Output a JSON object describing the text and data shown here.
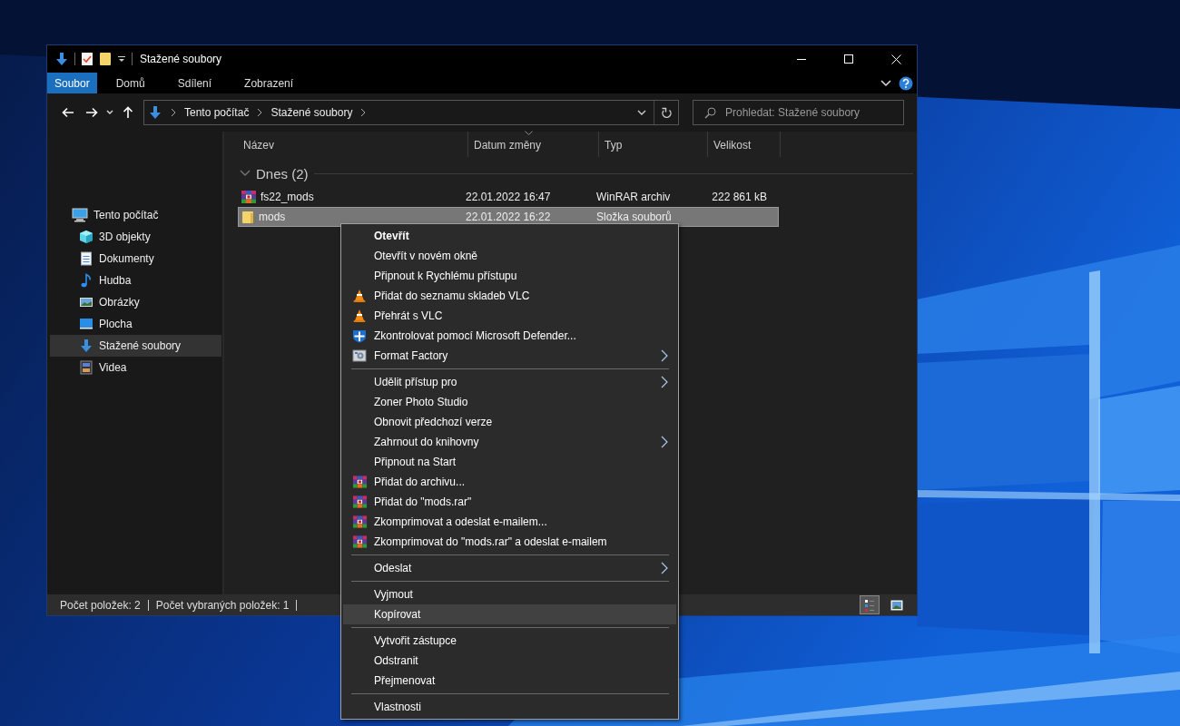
{
  "window": {
    "title": "Stažené soubory",
    "ribbon_tabs": [
      {
        "label": "Soubor",
        "selected": true
      },
      {
        "label": "Domů",
        "selected": false
      },
      {
        "label": "Sdílení",
        "selected": false
      },
      {
        "label": "Zobrazení",
        "selected": false
      }
    ],
    "address": {
      "crumbs": [
        "Tento počítač",
        "Stažené soubory"
      ]
    },
    "search": {
      "placeholder": "Prohledat: Stažené soubory"
    },
    "sidebar": {
      "items": [
        {
          "label": "Tento počítač",
          "kind": "pc",
          "selected": false,
          "children": [
            {
              "label": "3D objekty",
              "kind": "cube",
              "selected": false
            },
            {
              "label": "Dokumenty",
              "kind": "doc",
              "selected": false
            },
            {
              "label": "Hudba",
              "kind": "music",
              "selected": false
            },
            {
              "label": "Obrázky",
              "kind": "pictures",
              "selected": false
            },
            {
              "label": "Plocha",
              "kind": "desktop",
              "selected": false
            },
            {
              "label": "Stažené soubory",
              "kind": "download",
              "selected": true
            },
            {
              "label": "Videa",
              "kind": "video",
              "selected": false
            }
          ]
        }
      ]
    },
    "table": {
      "columns": [
        "Název",
        "Datum změny",
        "Typ",
        "Velikost"
      ],
      "group": "Dnes (2)",
      "rows": [
        {
          "name": "fs22_mods",
          "date": "22.01.2022 16:47",
          "type": "WinRAR archiv",
          "size": "222 861 kB",
          "kind": "archive",
          "selected": false
        },
        {
          "name": "mods",
          "date": "22.01.2022 16:22",
          "type": "Složka souborů",
          "kind": "folder",
          "selected": true
        }
      ]
    },
    "status_bar": {
      "items": [
        "Počet položek: 2",
        "Počet vybraných položek: 1"
      ],
      "views": [
        {
          "kind": "details",
          "selected": true
        },
        {
          "kind": "tiles",
          "selected": false
        }
      ]
    }
  },
  "context_menu": {
    "items": [
      {
        "kind": "plain",
        "label": "Otevřít",
        "default": true,
        "submenu": false,
        "selected": false
      },
      {
        "kind": "plain",
        "label": "Otevřít v novém okně",
        "default": false,
        "submenu": false,
        "selected": false
      },
      {
        "kind": "plain",
        "label": "Připnout k Rychlému přístupu",
        "default": false,
        "submenu": false,
        "selected": false
      },
      {
        "kind": "vlc",
        "label": "Přidat do seznamu skladeb VLC",
        "default": false,
        "submenu": false,
        "selected": false
      },
      {
        "kind": "vlc",
        "label": "Přehrát s VLC",
        "default": false,
        "submenu": false,
        "selected": false
      },
      {
        "kind": "defender",
        "label": "Zkontrolovat pomocí Microsoft Defender...",
        "default": false,
        "submenu": false,
        "selected": false
      },
      {
        "kind": "formatfactory",
        "label": "Format Factory",
        "default": false,
        "submenu": true,
        "selected": false
      },
      {
        "kind": "separator"
      },
      {
        "kind": "plain",
        "label": "Udělit přístup pro",
        "default": false,
        "submenu": true,
        "selected": false
      },
      {
        "kind": "plain",
        "label": "Zoner Photo Studio",
        "default": false,
        "submenu": false,
        "selected": false
      },
      {
        "kind": "plain",
        "label": "Obnovit předchozí verze",
        "default": false,
        "submenu": false,
        "selected": false
      },
      {
        "kind": "plain",
        "label": "Zahrnout do knihovny",
        "default": false,
        "submenu": true,
        "selected": false
      },
      {
        "kind": "plain",
        "label": "Připnout na Start",
        "default": false,
        "submenu": false,
        "selected": false
      },
      {
        "kind": "winrar",
        "label": "Přidat do archivu...",
        "default": false,
        "submenu": false,
        "selected": false
      },
      {
        "kind": "winrar",
        "label": "Přidat do \"mods.rar\"",
        "default": false,
        "submenu": false,
        "selected": false
      },
      {
        "kind": "winrar",
        "label": "Zkomprimovat a odeslat e-mailem...",
        "default": false,
        "submenu": false,
        "selected": false
      },
      {
        "kind": "winrar",
        "label": "Zkomprimovat do \"mods.rar\" a odeslat e-mailem",
        "default": false,
        "submenu": false,
        "selected": false
      },
      {
        "kind": "separator"
      },
      {
        "kind": "plain",
        "label": "Odeslat",
        "default": false,
        "submenu": true,
        "selected": false
      },
      {
        "kind": "separator"
      },
      {
        "kind": "plain",
        "label": "Vyjmout",
        "default": false,
        "submenu": false,
        "selected": false
      },
      {
        "kind": "plain",
        "label": "Kopírovat",
        "default": false,
        "submenu": false,
        "selected": true
      },
      {
        "kind": "separator"
      },
      {
        "kind": "plain",
        "label": "Vytvořit zástupce",
        "default": false,
        "submenu": false,
        "selected": false
      },
      {
        "kind": "plain",
        "label": "Odstranit",
        "default": false,
        "submenu": false,
        "selected": false
      },
      {
        "kind": "plain",
        "label": "Přejmenovat",
        "default": false,
        "submenu": false,
        "selected": false
      },
      {
        "kind": "separator"
      },
      {
        "kind": "plain",
        "label": "Vlastnosti",
        "default": false,
        "submenu": false,
        "selected": false
      }
    ]
  }
}
